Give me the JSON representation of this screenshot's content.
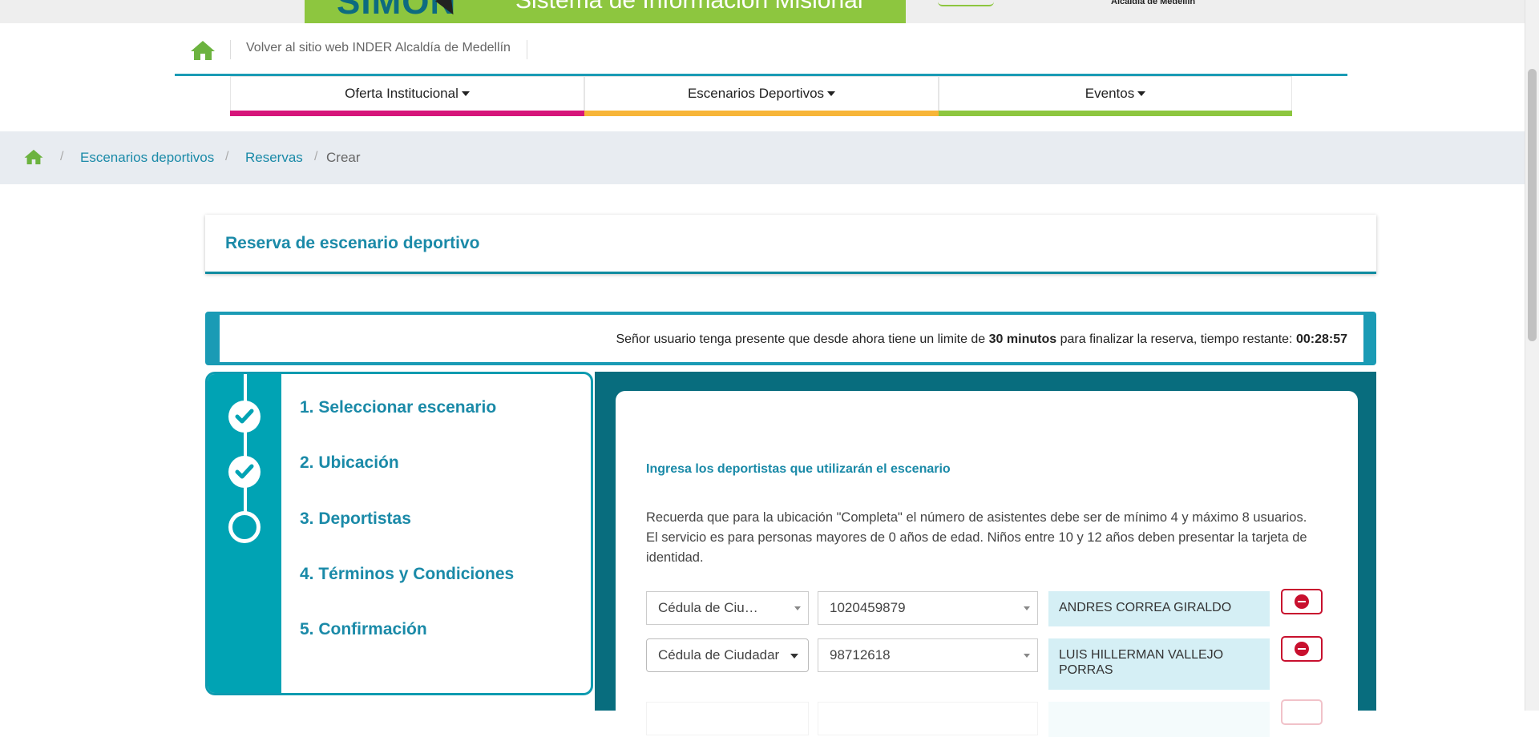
{
  "banner": {
    "logo_text": "SIMON",
    "system_name": "Sistema de Información Misional",
    "right_text": "Alcaldía de Medellín"
  },
  "header": {
    "back_link": "Volver al sitio web INDER Alcaldía de Medellín"
  },
  "nav": {
    "items": [
      {
        "label": "Oferta Institucional",
        "color": "#d6157a"
      },
      {
        "label": "Escenarios Deportivos",
        "color": "#f7b538"
      },
      {
        "label": "Eventos",
        "color": "#8dc63f"
      }
    ]
  },
  "breadcrumb": {
    "items": [
      "Escenarios deportivos",
      "Reservas"
    ],
    "current": "Crear",
    "separator": "/"
  },
  "page": {
    "title": "Reserva de escenario deportivo"
  },
  "timer": {
    "text_before": "Señor usuario tenga presente que desde ahora tiene un limite de",
    "limit": "30 minutos",
    "text_after": "para finalizar la reserva, tiempo restante:",
    "remaining": "00:28:57"
  },
  "steps": [
    {
      "label": "1. Seleccionar escenario",
      "state": "done"
    },
    {
      "label": "2. Ubicación",
      "state": "done"
    },
    {
      "label": "3. Deportistas",
      "state": "current"
    },
    {
      "label": "4. Términos y Condiciones",
      "state": "pending"
    },
    {
      "label": "5. Confirmación",
      "state": "pending"
    }
  ],
  "form": {
    "heading": "Ingresa los deportistas que utilizarán el escenario",
    "note": "Recuerda que para la ubicación \"Completa\" el número de asistentes debe ser de mínimo 4 y máximo 8 usuarios. El servicio es para personas mayores de 0 años de edad. Niños entre 10 y 12 años deben presentar la tarjeta de identidad.",
    "rows": [
      {
        "doc_type": "Cédula de Ciu…",
        "doc_number": "1020459879",
        "name": "ANDRES CORREA GIRALDO"
      },
      {
        "doc_type": "Cédula de Ciudadar",
        "doc_number": "98712618",
        "name": "LUIS HILLERMAN VALLEJO PORRAS"
      }
    ]
  },
  "colors": {
    "accent": "#1a9bb5",
    "dark_teal": "#086d7e",
    "link": "#1a8aa8",
    "danger": "#c8102e",
    "home_green": "#6cb33f"
  }
}
